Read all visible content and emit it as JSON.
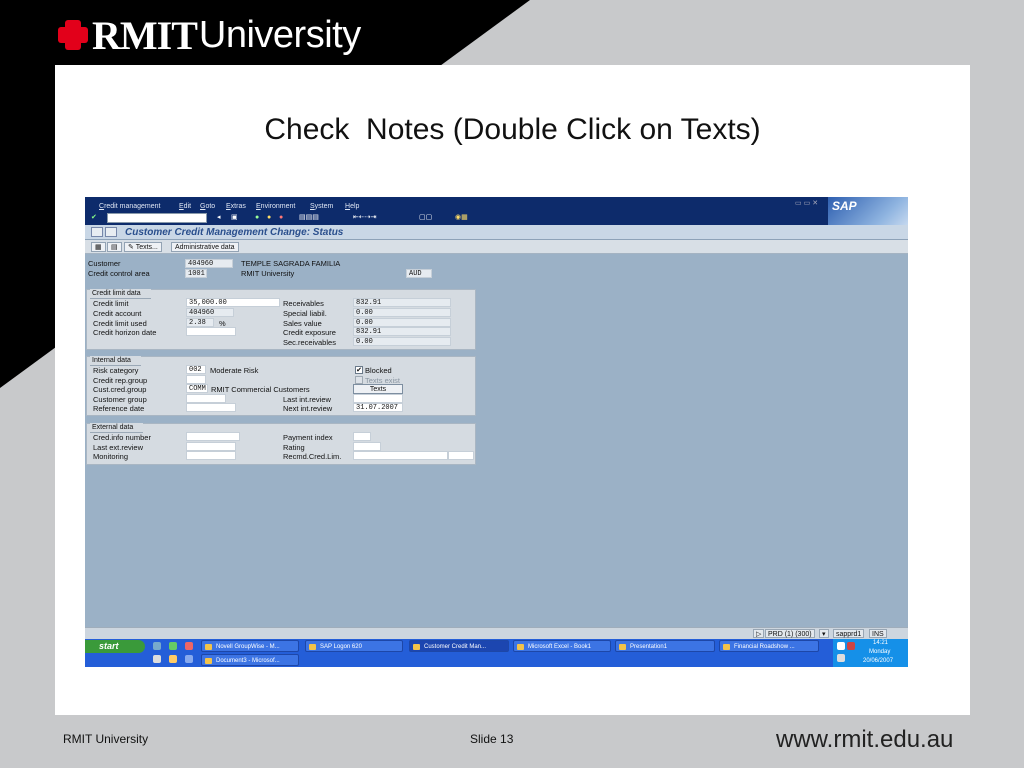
{
  "brand": {
    "name_bold": "RMIT",
    "name_rest": "University"
  },
  "slide": {
    "title": "Check  Notes (Double Click on Texts)"
  },
  "footer": {
    "left": "RMIT University",
    "slide_no": "Slide 13",
    "url": "www.rmit.edu.au"
  },
  "sap": {
    "menu": [
      "Credit management",
      "Edit",
      "Goto",
      "Extras",
      "Environment",
      "System",
      "Help"
    ],
    "logo": "SAP",
    "screen_title": "Customer Credit Management Change: Status",
    "app_toolbar": {
      "texts_btn": "Texts...",
      "admin_btn": "Administrative data"
    },
    "header": {
      "customer_label": "Customer",
      "customer_value": "404960",
      "customer_name": "TEMPLE SAGRADA FAMILIA",
      "cca_label": "Credit control area",
      "cca_value": "1001",
      "cca_name": "RMIT University",
      "currency": "AUD"
    },
    "credit_limit": {
      "caption": "Credit limit data",
      "credit_limit_label": "Credit limit",
      "credit_limit_value": "35,000.00",
      "credit_account_label": "Credit account",
      "credit_account_value": "404960",
      "limit_used_label": "Credit limit used",
      "limit_used_value": "2.38",
      "limit_used_unit": "%",
      "horizon_label": "Credit horizon date",
      "receivables_label": "Receivables",
      "receivables_value": "832.91",
      "special_label": "Special liabil.",
      "special_value": "0.00",
      "sales_label": "Sales value",
      "sales_value": "0.00",
      "exposure_label": "Credit exposure",
      "exposure_value": "832.91",
      "sec_label": "Sec.receivables",
      "sec_value": "0.00"
    },
    "internal": {
      "caption": "Internal data",
      "risk_label": "Risk category",
      "risk_value": "002",
      "risk_desc": "Moderate Risk",
      "blocked_label": "Blocked",
      "blocked_checked": true,
      "rep_group_label": "Credit rep.group",
      "texts_exist_label": "Texts exist",
      "cust_group_label": "Cust.cred.group",
      "cust_group_value": "COMM",
      "cust_group_desc": "RMIT Commercial Customers",
      "texts_button": "Texts",
      "cust_group2_label": "Customer group",
      "last_review_label": "Last int.review",
      "reference_label": "Reference date",
      "next_review_label": "Next int.review",
      "next_review_value": "31.07.2007"
    },
    "external": {
      "caption": "External data",
      "cred_info_label": "Cred.info number",
      "payment_index_label": "Payment index",
      "last_ext_label": "Last ext.review",
      "rating_label": "Rating",
      "monitoring_label": "Monitoring",
      "recmd_label": "Recmd.Cred.Lim."
    },
    "status": {
      "system": "PRD (1) (300)",
      "server": "sapprd1",
      "mode": "INS"
    },
    "taskbar": {
      "start": "start",
      "tasks": [
        "Novell GroupWise - M...",
        "SAP Logon 620",
        "Customer Credit Man...",
        "Microsoft Excel - Book1",
        "Presentation1",
        "Financial Roadshow ...",
        "Document3 - Microsof..."
      ],
      "time": "14:21",
      "day": "Monday",
      "date": "20/06/2007"
    }
  }
}
